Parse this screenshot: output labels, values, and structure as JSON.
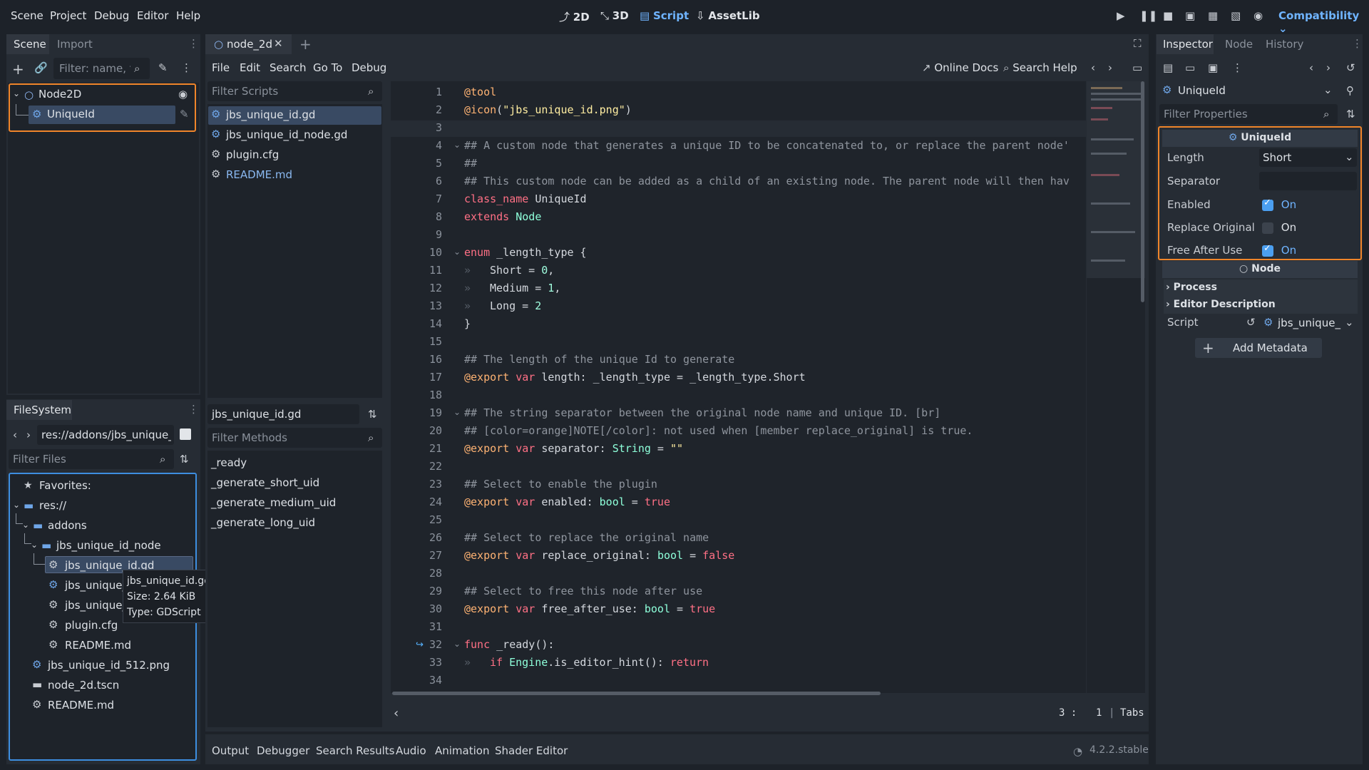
{
  "menu": [
    "Scene",
    "Project",
    "Debug",
    "Editor",
    "Help"
  ],
  "workspaces": [
    {
      "icon": "2d-icon",
      "label": "2D"
    },
    {
      "icon": "3d-icon",
      "label": "3D"
    },
    {
      "icon": "script-icon",
      "label": "Script"
    },
    {
      "icon": "assetlib-icon",
      "label": "AssetLib"
    }
  ],
  "renderer": "Compatibility",
  "scene_dock": {
    "tabs": [
      "Scene",
      "Import"
    ],
    "filter_placeholder": "Filter: name, t:t",
    "nodes": [
      {
        "name": "Node2D"
      },
      {
        "name": "UniqueId"
      }
    ]
  },
  "filesystem": {
    "tab": "FileSystem",
    "path": "res://addons/jbs_unique_id",
    "filter_placeholder": "Filter Files",
    "items": [
      "Favorites:",
      "res://",
      "addons",
      "jbs_unique_id_node",
      "jbs_unique_id.gd",
      "jbs_unique_i",
      "jbs_unique_i",
      "plugin.cfg",
      "README.md",
      "jbs_unique_id_512.png",
      "node_2d.tscn",
      "README.md"
    ],
    "tooltip": {
      "name": "jbs_unique_id.gd",
      "size": "Size: 2.64 KiB",
      "type": "Type: GDScript"
    }
  },
  "script_editor": {
    "scene_tab": "node_2d",
    "menus": [
      "File",
      "Edit",
      "Search",
      "Go To",
      "Debug"
    ],
    "online_docs": "Online Docs",
    "search_help": "Search Help",
    "filter_scripts_placeholder": "Filter Scripts",
    "scripts": [
      "jbs_unique_id.gd",
      "jbs_unique_id_node.gd",
      "plugin.cfg",
      "README.md"
    ],
    "current_script": "jbs_unique_id.gd",
    "filter_methods_placeholder": "Filter Methods",
    "methods": [
      "_ready",
      "_generate_short_uid",
      "_generate_medium_uid",
      "_generate_long_uid"
    ],
    "status": {
      "line": "3 :",
      "col": "1",
      "indent": "Tabs"
    }
  },
  "code_lines": [
    "@tool",
    "@icon(\"jbs_unique_id.png\")",
    "",
    "## A custom node that generates a unique ID to be concatenated to, or replace the parent node's",
    "##",
    "## This custom node can be added as a child of an existing node. The parent node will then have",
    "class_name UniqueId",
    "extends Node",
    "",
    "enum _length_type {",
    "Short = 0,",
    "Medium = 1,",
    "Long = 2",
    "}",
    "",
    "## The length of the unique Id to generate",
    "@export var length: _length_type = _length_type.Short",
    "",
    "## The string separator between the original node name and unique ID. [br]",
    "## [color=orange]NOTE[/color]: not used when [member replace_original] is true.",
    "@export var separator: String = \"\"",
    "",
    "## Select to enable the plugin",
    "@export var enabled: bool = true",
    "",
    "## Select to replace the original name",
    "@export var replace_original: bool = false",
    "",
    "## Select to free this node after use",
    "@export var free_after_use: bool = true",
    "",
    "func _ready():",
    "if Engine.is_editor_hint(): return",
    ""
  ],
  "line_numbers": [
    "1",
    "2",
    "3",
    "4",
    "5",
    "6",
    "7",
    "8",
    "9",
    "10",
    "11",
    "12",
    "13",
    "14",
    "15",
    "16",
    "17",
    "18",
    "19",
    "20",
    "21",
    "22",
    "23",
    "24",
    "25",
    "26",
    "27",
    "28",
    "29",
    "30",
    "31",
    "32",
    "33",
    "34"
  ],
  "inspector": {
    "tabs": [
      "Inspector",
      "Node",
      "History"
    ],
    "object": "UniqueId",
    "filter_placeholder": "Filter Properties",
    "section": "UniqueId",
    "properties": [
      {
        "label": "Length",
        "value": "Short"
      },
      {
        "label": "Separator",
        "value": ""
      },
      {
        "label": "Enabled",
        "value": "On",
        "checked": true
      },
      {
        "label": "Replace Original",
        "value": "On",
        "checked": false
      },
      {
        "label": "Free After Use",
        "value": "On",
        "checked": true
      }
    ],
    "node_section": "Node",
    "groups": [
      "Process",
      "Editor Description"
    ],
    "script_label": "Script",
    "script_value": "jbs_unique_",
    "add_metadata": "Add Metadata"
  },
  "bottom_panel": {
    "tabs": [
      "Output",
      "Debugger",
      "Search Results",
      "Audio",
      "Animation",
      "Shader Editor"
    ],
    "version": "4.2.2.stable"
  },
  "colors": {
    "accent": "#6fb4ff",
    "highlight": "#f0852a",
    "keyword": "#ff7085",
    "annotation": "#ffb373"
  }
}
